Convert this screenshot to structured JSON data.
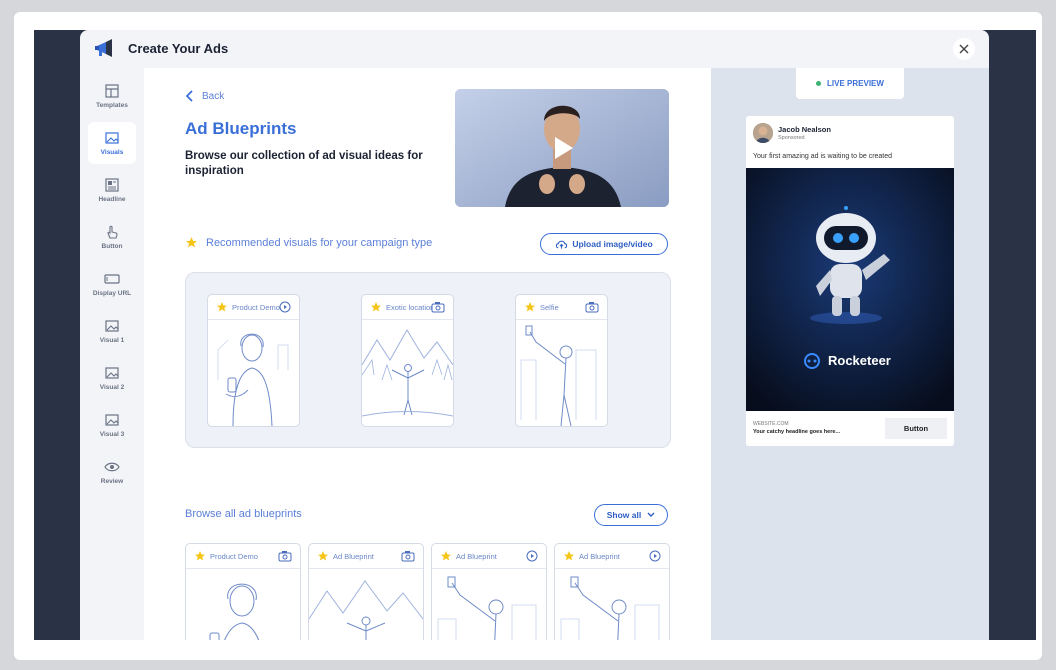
{
  "app": {
    "title": "Create Your Ads"
  },
  "sidebar": {
    "items": [
      {
        "label": "Templates",
        "icon": "templates-icon"
      },
      {
        "label": "Visuals",
        "icon": "image-icon",
        "active": true
      },
      {
        "label": "Headline",
        "icon": "headline-icon"
      },
      {
        "label": "Button",
        "icon": "pointer-icon"
      },
      {
        "label": "Display URL",
        "icon": "display-url-icon"
      },
      {
        "label": "Visual 1",
        "icon": "image-icon"
      },
      {
        "label": "Visual 2",
        "icon": "image-icon"
      },
      {
        "label": "Visual 3",
        "icon": "image-icon"
      },
      {
        "label": "Review",
        "icon": "eye-icon"
      }
    ]
  },
  "main": {
    "back_label": "Back",
    "title": "Ad Blueprints",
    "subtitle": "Browse our collection of ad visual ideas for inspiration",
    "recommended_label": "Recommended visuals for your campaign type",
    "upload_label": "Upload image/video",
    "recommended": [
      {
        "label": "Product Demo",
        "media": "play-icon"
      },
      {
        "label": "Exotic location",
        "media": "camera-icon"
      },
      {
        "label": "Selfie",
        "media": "camera-icon"
      }
    ],
    "browse_label": "Browse all ad blueprints",
    "show_all_label": "Show all",
    "browse": [
      {
        "label": "Product Demo",
        "media": "camera-icon"
      },
      {
        "label": "Ad Blueprint",
        "media": "camera-icon"
      },
      {
        "label": "Ad Blueprint",
        "media": "play-icon"
      },
      {
        "label": "Ad Blueprint",
        "media": "play-icon"
      }
    ]
  },
  "preview": {
    "live_label": "LIVE PREVIEW",
    "author": "Jacob Nealson",
    "sponsored": "Sponsored",
    "message": "Your first amazing ad is waiting to be created",
    "brand": "Rocketeer",
    "website": "WEBSITE.COM",
    "headline": "Your catchy headline goes here...",
    "button_label": "Button"
  },
  "colors": {
    "accent": "#3a6fd8",
    "dark": "#2a3346",
    "ad_bg": "#0b1326"
  }
}
